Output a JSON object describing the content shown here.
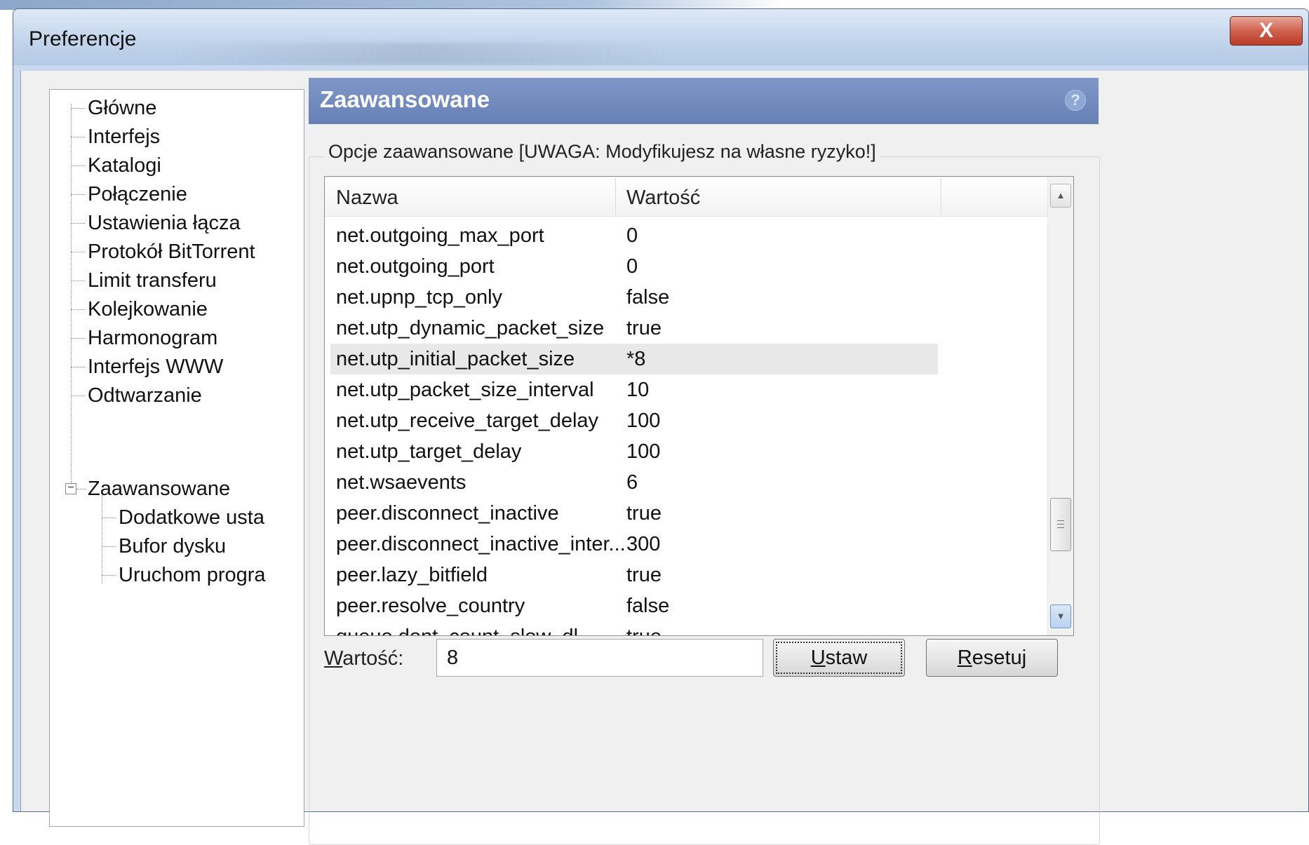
{
  "window": {
    "title": "Preferencje",
    "close_label": "X"
  },
  "tree": {
    "items": [
      {
        "label": "Główne"
      },
      {
        "label": "Interfejs"
      },
      {
        "label": "Katalogi"
      },
      {
        "label": "Połączenie"
      },
      {
        "label": "Ustawienia łącza"
      },
      {
        "label": "Protokół BitTorrent"
      },
      {
        "label": "Limit transferu"
      },
      {
        "label": "Kolejkowanie"
      },
      {
        "label": "Harmonogram"
      },
      {
        "label": "Interfejs WWW"
      },
      {
        "label": "Odtwarzanie"
      },
      {
        "label": "Zaawansowane",
        "expanded": true,
        "selected": true
      },
      {
        "label": "Dodatkowe usta"
      },
      {
        "label": "Bufor dysku"
      },
      {
        "label": "Uruchom progra"
      }
    ]
  },
  "panel": {
    "title": "Zaawansowane",
    "help_icon": "?",
    "group_label": "Opcje zaawansowane [UWAGA: Modyfikujesz na własne ryzyko!]"
  },
  "list": {
    "columns": [
      "Nazwa",
      "Wartość"
    ],
    "rows": [
      {
        "name": "net.outgoing_max_port",
        "value": "0"
      },
      {
        "name": "net.outgoing_port",
        "value": "0"
      },
      {
        "name": "net.upnp_tcp_only",
        "value": "false"
      },
      {
        "name": "net.utp_dynamic_packet_size",
        "value": "true"
      },
      {
        "name": "net.utp_initial_packet_size",
        "value": "*8",
        "selected": true
      },
      {
        "name": "net.utp_packet_size_interval",
        "value": "10"
      },
      {
        "name": "net.utp_receive_target_delay",
        "value": "100"
      },
      {
        "name": "net.utp_target_delay",
        "value": "100"
      },
      {
        "name": "net.wsaevents",
        "value": "6"
      },
      {
        "name": "peer.disconnect_inactive",
        "value": "true"
      },
      {
        "name": "peer.disconnect_inactive_inter...",
        "value": "300"
      },
      {
        "name": "peer.lazy_bitfield",
        "value": "true"
      },
      {
        "name": "peer.resolve_country",
        "value": "false"
      },
      {
        "name": "queue.dont_count_slow_dl",
        "value": "true"
      }
    ]
  },
  "controls": {
    "value_label_prefix": "W",
    "value_label_rest": "artość:",
    "value_input": "8",
    "set_button_prefix": "U",
    "set_button_rest": "staw",
    "reset_button_prefix": "R",
    "reset_button_rest": "esetuj"
  }
}
